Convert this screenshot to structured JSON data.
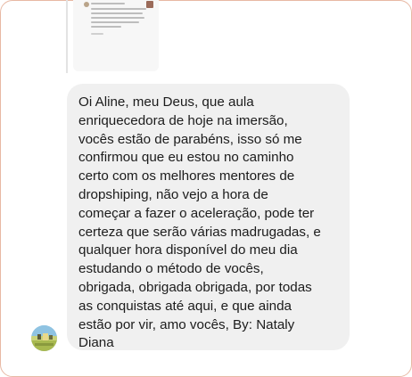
{
  "message": {
    "text": "Oi Aline, meu Deus, que aula\nenriquecedora de hoje na imersão,\nvocês estão de parabéns, isso só me\nconfirmou que eu estou no caminho\ncerto com os melhores mentores de\ndropshiping, não vejo a hora de\ncomeçar a fazer o aceleração, pode ter\ncerteza que serão várias madrugadas, e\nqualquer hora disponível do meu dia\nestudando o método de vocês,\nobrigada, obrigada obrigada, por todas\nas conquistas até aqui, e que ainda\nestão por vir, amo vocês, By: Nataly\nDiana"
  },
  "colors": {
    "bubble": "#f0f0f0",
    "text": "#1c1c1c",
    "frame_border": "#e8b9a4",
    "thread_line": "#e3e3e3"
  },
  "icons": {
    "sender_avatar": "profile-photo"
  }
}
